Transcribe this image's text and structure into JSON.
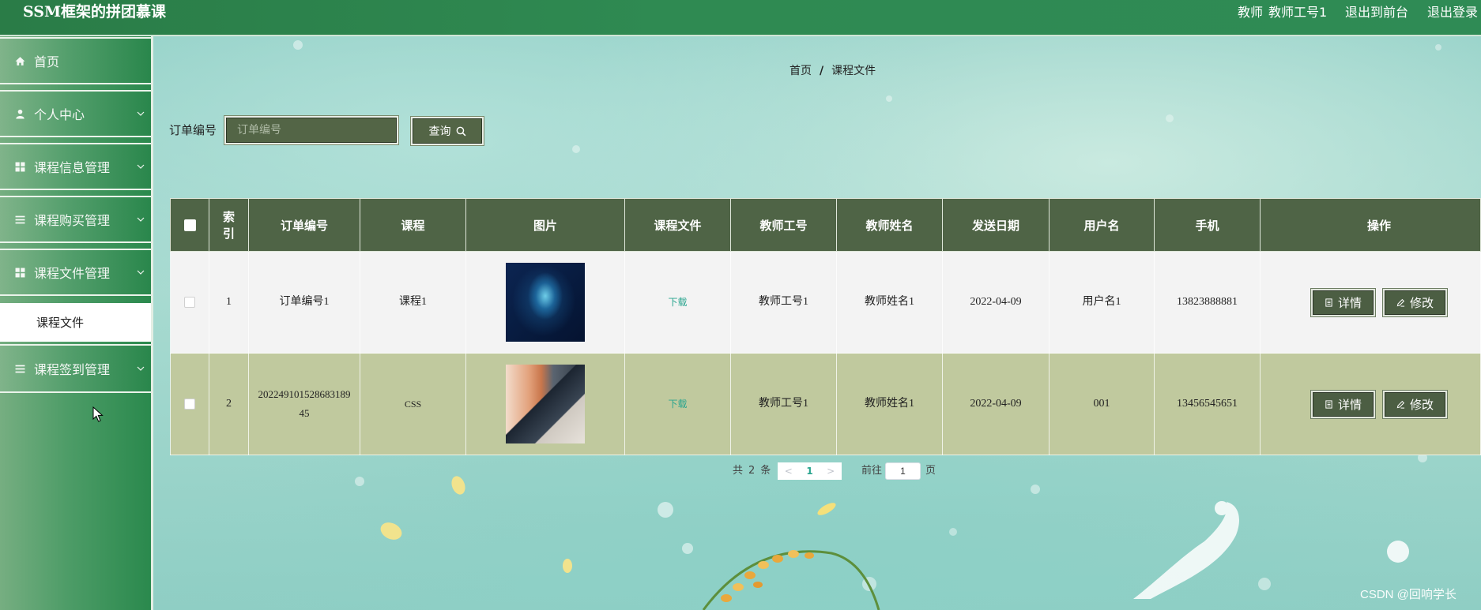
{
  "header": {
    "title": "SSM框架的拼团慕课",
    "role": "教师",
    "username": "教师工号1",
    "front_link": "退出到前台",
    "logout_link": "退出登录"
  },
  "sidebar": {
    "items": [
      {
        "label": "首页",
        "icon": "home-icon",
        "has_submenu": false
      },
      {
        "label": "个人中心",
        "icon": "user-icon",
        "has_submenu": true
      },
      {
        "label": "课程信息管理",
        "icon": "grid-icon",
        "has_submenu": true
      },
      {
        "label": "课程购买管理",
        "icon": "list-icon",
        "has_submenu": true
      },
      {
        "label": "课程文件管理",
        "icon": "grid-icon",
        "has_submenu": true,
        "expanded": true
      },
      {
        "label": "课程签到管理",
        "icon": "list-icon",
        "has_submenu": true
      }
    ],
    "submenu": {
      "label": "课程文件",
      "active": true
    }
  },
  "breadcrumb": {
    "home": "首页",
    "separator": "/",
    "current": "课程文件"
  },
  "search": {
    "label": "订单编号",
    "placeholder": "订单编号",
    "value": "",
    "button_label": "查询",
    "button_icon": "search-icon"
  },
  "table": {
    "columns": [
      "索引",
      "订单编号",
      "课程",
      "图片",
      "课程文件",
      "教师工号",
      "教师姓名",
      "发送日期",
      "用户名",
      "手机",
      "操作"
    ],
    "rows": [
      {
        "index": "1",
        "order_no": "订单编号1",
        "course": "课程1",
        "file_link": "下载",
        "teacher_id": "教师工号1",
        "teacher_name": "教师姓名1",
        "send_date": "2022-04-09",
        "username": "用户名1",
        "phone": "13823888881",
        "checked": false
      },
      {
        "index": "2",
        "order_no": "20224910152868318945",
        "course": "CSS",
        "file_link": "下载",
        "teacher_id": "教师工号1",
        "teacher_name": "教师姓名1",
        "send_date": "2022-04-09",
        "username": "001",
        "phone": "13456545651",
        "checked": false
      }
    ],
    "actions": {
      "detail_label": "详情",
      "detail_icon": "document-icon",
      "edit_label": "修改",
      "edit_icon": "pencil-icon"
    }
  },
  "pagination": {
    "total_prefix": "共",
    "total": "2",
    "total_suffix": "条",
    "prev": "<",
    "current_page": "1",
    "next": ">",
    "goto_label": "前往",
    "goto_value": "1",
    "page_suffix": "页"
  },
  "watermark": "CSDN @回响学长",
  "colors": {
    "header": "#2f8a52",
    "table_header": "#4f6446",
    "row": "#f3f3f3",
    "row_alt": "#c0c99e",
    "link": "#2aa58f",
    "button": "#4c5e43"
  }
}
